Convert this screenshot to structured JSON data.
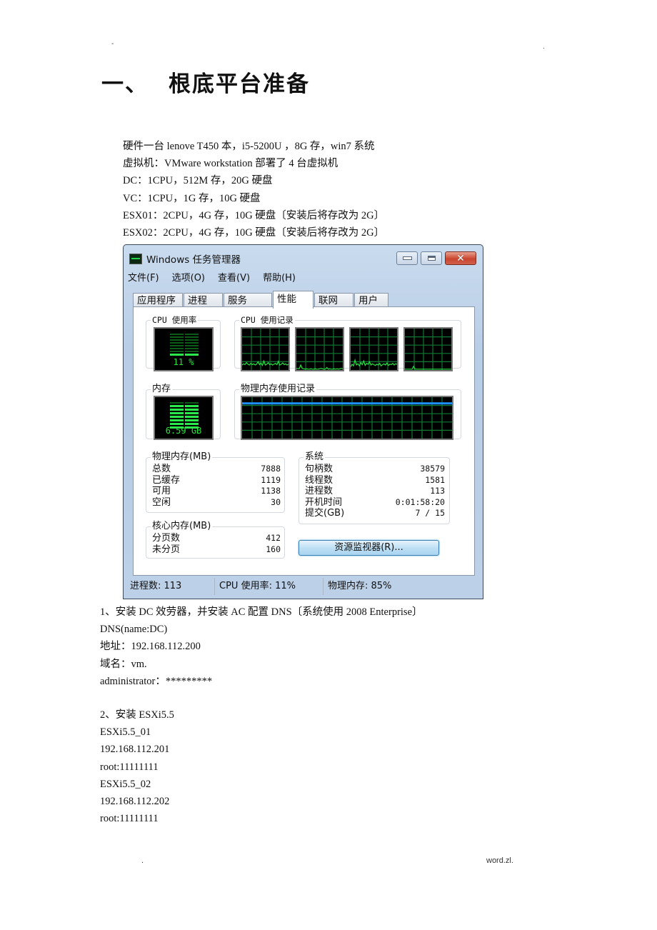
{
  "header": {
    "left_mark": "-",
    "right_mark": "."
  },
  "title": {
    "number": "一、",
    "text": "根底平台准备"
  },
  "intro_lines": [
    "硬件一台 lenove T450 本，i5-5200U ，8G 存，win7 系统",
    "虚拟机：VMware workstation 部署了 4 台虚拟机",
    "DC：1CPU，512M 存，20G 硬盘",
    "VC：1CPU，1G 存，10G 硬盘",
    "ESX01：2CPU，4G 存，10G 硬盘〔安装后将存改为 2G〕",
    "ESX02：2CPU，4G 存，10G 硬盘〔安装后将存改为 2G〕"
  ],
  "task_manager": {
    "window_title": "Windows 任务管理器",
    "icons": {
      "app": "task-manager-icon",
      "minimize": "minimize-icon",
      "maximize": "maximize-icon",
      "close": "close-icon"
    },
    "menu": [
      "文件(F)",
      "选项(O)",
      "查看(V)",
      "帮助(H)"
    ],
    "tabs": [
      {
        "label": "应用程序",
        "active": false
      },
      {
        "label": "进程",
        "active": false
      },
      {
        "label": "服务",
        "active": false
      },
      {
        "label": "性能",
        "active": true
      },
      {
        "label": "联网",
        "active": false
      },
      {
        "label": "用户",
        "active": false
      }
    ],
    "cpu_usage": {
      "label": "CPU 使用率",
      "value_text": "11 %",
      "percent": 11
    },
    "cpu_history": {
      "label": "CPU 使用记录",
      "cores": [
        [
          12,
          15,
          13,
          18,
          14,
          12,
          16,
          13,
          15,
          12,
          14,
          20,
          13,
          17,
          11,
          22,
          12,
          14,
          18,
          13,
          15,
          12,
          14,
          16,
          13,
          21,
          12,
          14,
          17,
          13,
          15,
          12,
          14
        ],
        [
          3,
          4,
          3,
          12,
          4,
          3,
          2,
          3,
          2,
          2,
          3,
          2,
          2,
          3,
          2,
          2,
          3,
          4,
          3,
          2,
          2,
          6,
          2,
          3,
          2,
          2,
          3,
          2,
          3,
          2,
          3,
          4,
          3
        ],
        [
          8,
          14,
          10,
          24,
          12,
          15,
          10,
          18,
          13,
          22,
          11,
          16,
          14,
          20,
          12,
          15,
          13,
          11,
          14,
          12,
          16,
          10,
          13,
          15,
          12,
          17,
          11,
          14,
          13,
          16,
          12,
          15,
          14
        ],
        [
          2,
          2,
          2,
          2,
          2,
          2,
          9,
          2,
          2,
          2,
          2,
          2,
          2,
          2,
          2,
          2,
          2,
          2,
          2,
          2,
          2,
          2,
          2,
          2,
          2,
          2,
          2,
          2,
          2,
          2,
          2,
          2,
          2
        ]
      ]
    },
    "memory": {
      "label": "内存",
      "value_text": "6.59 GB",
      "percent": 85
    },
    "memory_history": {
      "label": "物理内存使用记录",
      "percent": 85
    },
    "physical_memory": {
      "label": "物理内存(MB)",
      "rows": [
        {
          "name": "总数",
          "value": "7888"
        },
        {
          "name": "已缓存",
          "value": "1119"
        },
        {
          "name": "可用",
          "value": "1138"
        },
        {
          "name": "空闲",
          "value": "30"
        }
      ]
    },
    "kernel_memory": {
      "label": "核心内存(MB)",
      "rows": [
        {
          "name": "分页数",
          "value": "412"
        },
        {
          "name": "未分页",
          "value": "160"
        }
      ]
    },
    "system": {
      "label": "系统",
      "rows": [
        {
          "name": "句柄数",
          "value": "38579"
        },
        {
          "name": "线程数",
          "value": "1581"
        },
        {
          "name": "进程数",
          "value": "113"
        },
        {
          "name": "开机时间",
          "value": "0:01:58:20"
        },
        {
          "name": "提交(GB)",
          "value": "7 / 15"
        }
      ]
    },
    "resource_monitor_button": "资源监视器(R)...",
    "status_bar": [
      "进程数: 113",
      "CPU 使用率: 11%",
      "物理内存: 85%"
    ],
    "colors": {
      "graph_line": "#27e23f",
      "grid": "#0e7a34",
      "memory_line": "#1e90ff"
    }
  },
  "section1": {
    "heading": "1、安装 DC 效劳器，并安装 AC 配置 DNS〔系统使用 2008 Enterprise〕",
    "lines": [
      "DNS(name:DC)",
      "地址：192.168.112.200",
      "域名：vm.",
      "administrator：*********"
    ]
  },
  "section2": {
    "heading": "2、安装 ESXi5.5",
    "lines": [
      "ESXi5.5_01",
      "192.168.112.201",
      "root:11111111",
      "ESXi5.5_02",
      "192.168.112.202",
      "root:11111111"
    ]
  },
  "footer": {
    "left_mark": ".",
    "right_text": "word.zl."
  }
}
